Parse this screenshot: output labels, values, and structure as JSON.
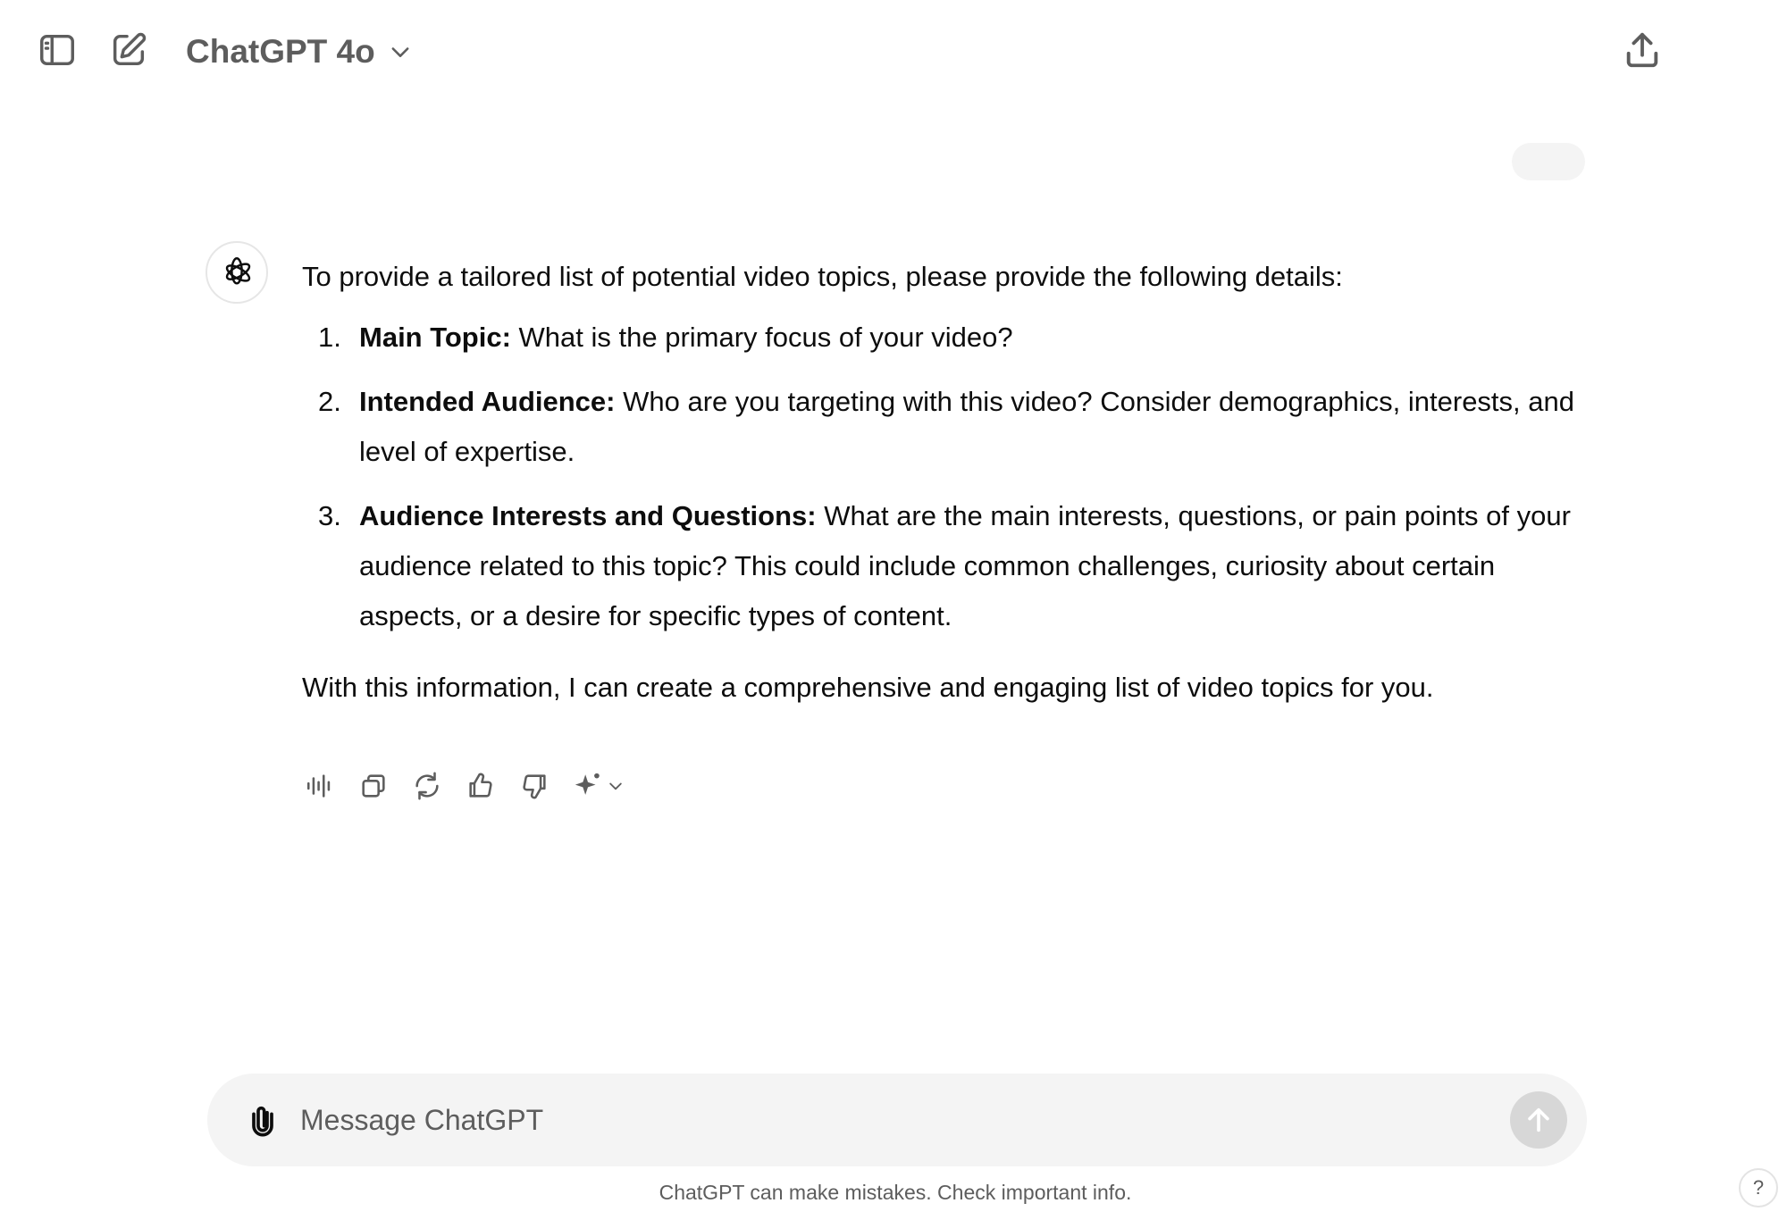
{
  "header": {
    "model_name": "ChatGPT 4o",
    "icons": {
      "sidebar_toggle": "sidebar-icon",
      "new_chat": "edit-icon",
      "model_chevron": "chevron-down-icon",
      "share": "share-icon"
    }
  },
  "conversation": {
    "user_message": "",
    "assistant": {
      "intro": "To provide a tailored list of potential video topics, please provide the following details:",
      "items": [
        {
          "number": "1.",
          "title": "Main Topic:",
          "text": " What is the primary focus of your video?"
        },
        {
          "number": "2.",
          "title": "Intended Audience:",
          "text": " Who are you targeting with this video? Consider demographics, interests, and level of expertise."
        },
        {
          "number": "3.",
          "title": "Audience Interests and Questions:",
          "text": " What are the main interests, questions, or pain points of your audience related to this topic? This could include common challenges, curiosity about certain aspects, or a desire for specific types of content."
        }
      ],
      "outro": "With this information, I can create a comprehensive and engaging list of video topics for you."
    },
    "actions": [
      "read-aloud-icon",
      "copy-icon",
      "regenerate-icon",
      "thumbs-up-icon",
      "thumbs-down-icon",
      "sparkle-icon"
    ]
  },
  "composer": {
    "placeholder": "Message ChatGPT",
    "value": ""
  },
  "footer": {
    "disclaimer": "ChatGPT can make mistakes. Check important info.",
    "help": "?"
  },
  "colors": {
    "text": "#0d0d0d",
    "muted": "#5d5d5d",
    "composer_bg": "#f4f4f4",
    "send_disabled": "#d7d7d7"
  }
}
